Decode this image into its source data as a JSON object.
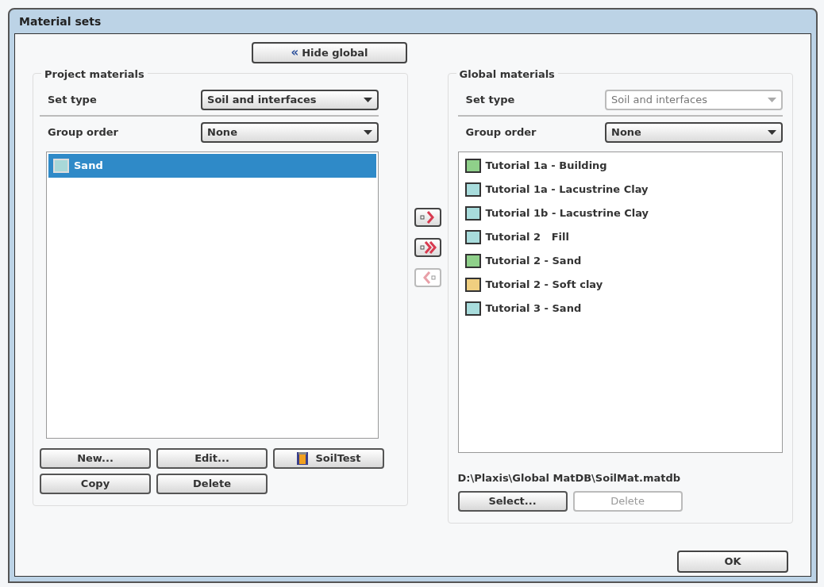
{
  "window": {
    "title": "Material sets"
  },
  "toggle_button": {
    "label": "Hide global",
    "icon": "«"
  },
  "project": {
    "title": "Project materials",
    "fields": [
      {
        "label": "Set type",
        "value": "Soil and interfaces",
        "disabled": false
      },
      {
        "label": "Group order",
        "value": "None",
        "disabled": false
      }
    ],
    "items": [
      {
        "label": "Sand",
        "color": "#a8d8d8",
        "selected": true
      }
    ],
    "buttons": [
      {
        "label": "New...",
        "kind": "plain",
        "disabled": false
      },
      {
        "label": "Edit...",
        "kind": "plain",
        "disabled": false
      },
      {
        "label": "SoilTest",
        "kind": "soiltest",
        "disabled": false
      },
      {
        "label": "Copy",
        "kind": "plain",
        "disabled": false
      },
      {
        "label": "Delete",
        "kind": "plain",
        "disabled": false
      }
    ]
  },
  "transfer_buttons": [
    {
      "kind": "copy-one",
      "disabled": false
    },
    {
      "kind": "copy-all",
      "disabled": false
    },
    {
      "kind": "copy-back",
      "disabled": true
    }
  ],
  "global": {
    "title": "Global materials",
    "fields": [
      {
        "label": "Set type",
        "value": "Soil and interfaces",
        "disabled": true
      },
      {
        "label": "Group order",
        "value": "None",
        "disabled": false
      }
    ],
    "items": [
      {
        "label": "Tutorial 1a - Building",
        "color": "#8fd08a",
        "selected": false
      },
      {
        "label": "Tutorial 1a - Lacustrine Clay",
        "color": "#a8dcdc",
        "selected": false
      },
      {
        "label": "Tutorial 1b - Lacustrine Clay",
        "color": "#a8dcdc",
        "selected": false
      },
      {
        "label": "Tutorial 2   Fill",
        "color": "#a8dcdc",
        "selected": false
      },
      {
        "label": "Tutorial 2 - Sand",
        "color": "#8fd08a",
        "selected": false
      },
      {
        "label": "Tutorial 2 - Soft clay",
        "color": "#f0cf80",
        "selected": false
      },
      {
        "label": "Tutorial 3 - Sand",
        "color": "#a8dcdc",
        "selected": false
      }
    ],
    "path": "D:\\Plaxis\\Global MatDB\\SoilMat.matdb",
    "buttons": [
      {
        "label": "Select...",
        "disabled": false
      },
      {
        "label": "Delete",
        "disabled": true
      }
    ]
  },
  "ok_button": {
    "label": "OK"
  }
}
